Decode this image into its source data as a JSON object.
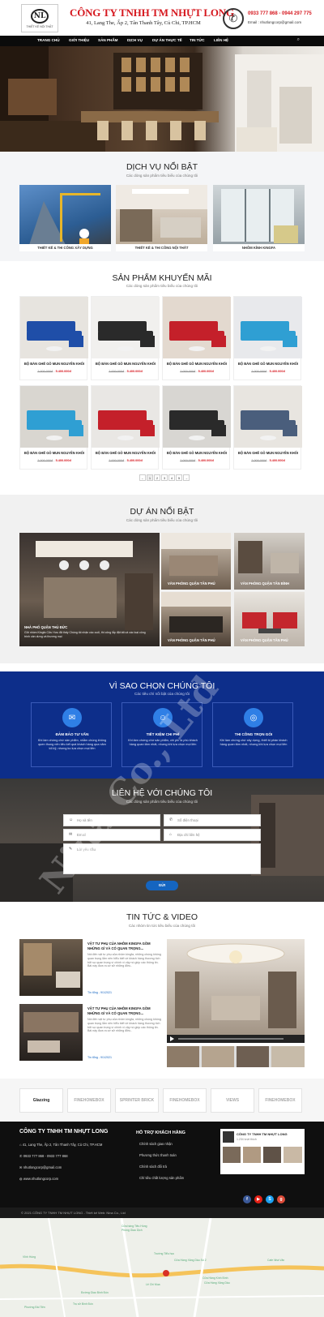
{
  "header": {
    "logo_caption": "THIẾT KẾ NỘI THẤT",
    "company": "CÔNG TY TNHH TM NHỰT LONG",
    "address": "41, Lang The, Ấp 2, Tân Thanh Tây, Củ Chi, TP.HCM",
    "phones": "0933 777 868 - 0944 297 775",
    "email": "Email : nhutlongcorp@gmail.com"
  },
  "nav": {
    "items": [
      "TRANG CHỦ",
      "GIỚI THIỆU",
      "SẢN PHẨM",
      "DỊCH VỤ",
      "DỰ ÁN THỰC TẾ",
      "TIN TỨC",
      "LIÊN HỆ"
    ]
  },
  "services": {
    "title": "DỊCH VỤ NỔI BẬT",
    "subtitle": "Các dòng sản phẩm tiêu biểu của chúng tôi",
    "cards": [
      "THIẾT KẾ & THI CÔNG XÂY DỰNG",
      "THIẾT KẾ & THI CÔNG NỘI THẤT",
      "NHÔM KÍNH KINGFA"
    ]
  },
  "products": {
    "title": "SẢN PHẨM KHUYẾN MÃI",
    "subtitle": "Các dòng sản phẩm tiêu biểu của chúng tôi",
    "item_name": "BỘ BÀN GHẾ GỖ MUN NGUYÊN KHỐI",
    "old_price": "7.000.000đ",
    "new_price": "5.400.000đ",
    "pagination": [
      "←",
      "1",
      "2",
      "3",
      "4",
      "5",
      "→"
    ]
  },
  "projects": {
    "title": "DỰ ÁN NỔI BẬT",
    "subtitle": "Các dòng sản phẩm tiêu biểu của chúng tôi",
    "big_caption": "NHÀ PHỐ QUẬN THỦ ĐỨC",
    "big_desc": "Gửi nhóm Kingfa Cửu Hưu đã thấy Chúng tôi nhận các cuối, thi công lắp đặt tất cả các loại công trình cần dưng và thương mại",
    "small_captions": [
      "VĂN PHÒNG QUẬN TÂN PHÚ",
      "VĂN PHÒNG QUẬN TÂN BÌNH",
      "VĂN PHÒNG QUẬN TÂN PHÚ",
      "VĂN PHÒNG QUẬN TÂN PHÚ"
    ]
  },
  "why": {
    "title": "VÌ SAO CHỌN CHÚNG TÔI",
    "subtitle": "Các tiêu chí nổi bật của chúng tôi",
    "items": [
      {
        "title": "ĐẢM BẢO TƯ VẤN",
        "desc": "Khi làm chứng chứ sản phẩm, nhằm chúng không quen thung nên tiêu kết quả khách hàng qua năm tối kỹ, nhưng ko lựa chọn mọi liên"
      },
      {
        "title": "TIẾT KIỆM CHI PHÍ",
        "desc": "Khi làm chứng chứ sản phẩm, chi phí là phù khách hàng quan tâm nhất, nhưng khi lựa chọn mọi liên"
      },
      {
        "title": "THI CÔNG TRỌN GÓI",
        "desc": "Khi làm chứng chứ xây dựng, thiết bị phần khách hàng quan tâm nhất, nhưng khi lựa chọn mọi liên"
      }
    ]
  },
  "contact": {
    "title": "LIÊN HỆ VỚI CHÚNG TÔI",
    "subtitle": "Các dòng sản phẩm tiêu biểu của chúng tôi",
    "name_ph": "Họ và tên",
    "phone_ph": "Số điện thoại",
    "email_ph": "Email",
    "address_ph": "Địa chỉ liên hệ",
    "message_ph": "Lời yêu cầu",
    "send": "GỬI"
  },
  "news": {
    "title": "TIN TỨC & VIDEO",
    "subtitle": "Các nhóm tin tức tiêu biểu của chúng tôi",
    "items": [
      {
        "title": "VẬT TƯ PHỤ CỦA NHÔM KINGFA GỒM NHỮNG GÌ VÀ CÓ QUAN TRỌNG...",
        "desc": "Nói đến vật tư phụ của nhôm kingfa, những chúng không quan trọng lắm nên hiểu biết về khách hàng thương tích bởi sự quan trọng vì chính vì vậy nó giúp các thông tin. Bài này đưa ra cơ sở những điều..",
        "meta": "Tin tổng - 9/1/2021"
      },
      {
        "title": "VẬT TƯ PHỤ CỦA NHÔM KINGFA GỒM NHỮNG GÌ VÀ CÓ QUAN TRỌNG...",
        "desc": "Nói đến vật tư phụ của nhôm kingfa, những chúng không quan trọng lắm nên hiểu biết về khách hàng thương tích bởi sự quan trọng vì chính vì vậy nó giúp các thông tin. Bài này đưa ra cơ sở những điều..",
        "meta": "Tin tổng - 9/1/2021"
      }
    ]
  },
  "partners": [
    "Glazzing",
    "FINEHOMEBOX",
    "SPRINTER BRICK",
    "FINEHOMEBOX",
    "VIEWS",
    "FINEHOMEBOX"
  ],
  "footer": {
    "company": "CÔNG TY TNHH TM NHỰT LONG",
    "address": "41, Lang The, Ấp 2, Tân Thanh Tây, Củ Chi, TP.HCM",
    "phone": "0933 777 868 - 0933 777 868",
    "email": "nhutlongcorp@gmail.com",
    "web": "www.nhutlongcorp.com",
    "support_title": "HỖ TRỢ KHÁCH HÀNG",
    "support": [
      "Chính sách giao nhận",
      "Phương thức thanh toán",
      "Chính sách đổi trả",
      "Chỉ tiêu chất lượng sản phẩm"
    ],
    "fanpage": "CÔNG TY TNHH TM NHỰT LONG",
    "fanpage_likes": "1.234 lượt thích",
    "copyright": "© 2021 CÔNG TY TNHH TM NHỰT LONG - Thiết kế Web: Nina Co., Ltd"
  },
  "map": {
    "labels": [
      "Cửa hàng Tiêu Hùng",
      "Phòng Giao Dịch",
      "Vĩnh Hùng",
      "Trường Tiểu học",
      "Lê Chí Mua",
      "Đường Giao Bình Đức",
      "Cửa Hàng Kính Bình",
      "Cửa Hàng Xăng Dầu",
      "Trụ sở Bình Đức",
      "Cửa Hàng Xăng Dầu Số 2",
      "Phường Đài Tiên",
      "Cafe Nhà Văn"
    ]
  },
  "watermark": "Nina Co., Ltd"
}
